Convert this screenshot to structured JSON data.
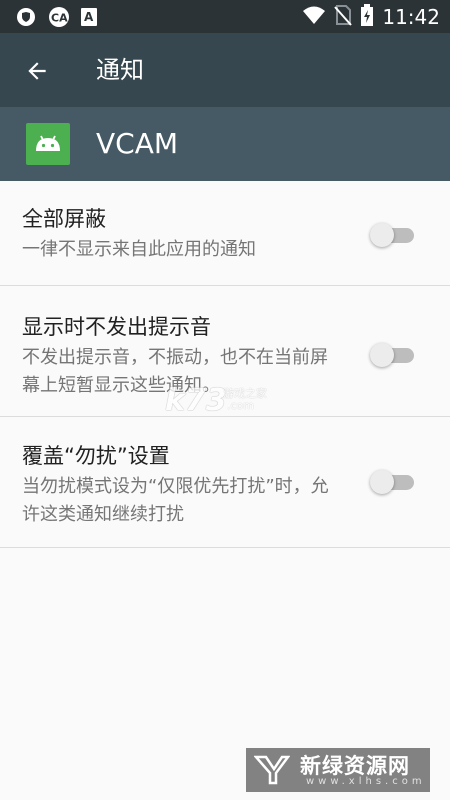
{
  "status_bar": {
    "time": "11:42",
    "left_icons": [
      "vpn-shield-icon",
      "infinity-app-icon",
      "font-a-icon"
    ],
    "right_icons": [
      "wifi-icon",
      "no-sim-icon",
      "battery-charging-icon"
    ]
  },
  "toolbar": {
    "title": "通知",
    "back_icon": "arrow-back-icon"
  },
  "app": {
    "name": "VCAM",
    "icon": "android-icon"
  },
  "settings": [
    {
      "title": "全部屏蔽",
      "description": "一律不显示来自此应用的通知",
      "enabled": false
    },
    {
      "title": "显示时不发出提示音",
      "description": "不发出提示音，不振动，也不在当前屏幕上短暂显示这些通知。",
      "enabled": false
    },
    {
      "title": "覆盖“勿扰”设置",
      "description": "当勿扰模式设为“仅限优先打扰”时，允许这类通知继续打扰",
      "enabled": false
    }
  ],
  "watermarks": {
    "center_logo": "k73",
    "center_sub": "游戏之家",
    "center_url": ".com",
    "corner_title": "新绿资源网",
    "corner_url": "www.xlhs.com"
  },
  "colors": {
    "status_bar": "#2b3336",
    "toolbar": "#37474f",
    "app_header": "#455a64",
    "app_icon": "#4caf50",
    "background": "#fafafa"
  }
}
